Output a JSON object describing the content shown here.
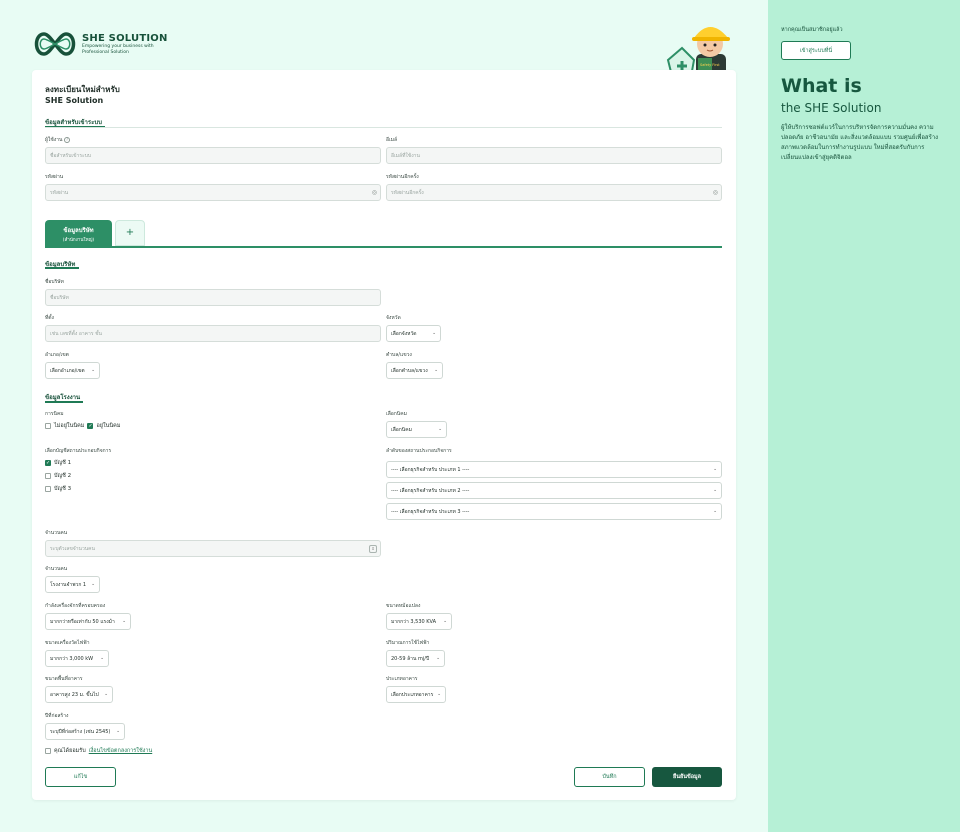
{
  "brand": {
    "name": "SHE SOLUTION",
    "tagline": "Empowering your business with Professional Solution"
  },
  "mascot": {
    "badge": "Safety First"
  },
  "header": {
    "title_line1": "ลงทะเบียนใหม่สำหรับ",
    "title_line2": "SHE Solution"
  },
  "login_section": {
    "heading": "ข้อมูลสำหรับเข้าระบบ",
    "username": {
      "label": "ผู้ใช้งาน",
      "placeholder": "ชื่อสำหรับเข้าระบบ"
    },
    "email": {
      "label": "อีเมล์",
      "placeholder": "อีเมล์ที่ใช้งาน"
    },
    "password": {
      "label": "รหัสผ่าน",
      "placeholder": "รหัสผ่าน"
    },
    "confirm_password": {
      "label": "รหัสผ่านอีกครั้ง",
      "placeholder": "รหัสผ่านอีกครั้ง"
    }
  },
  "tabs": {
    "active_title": "ข้อมูลบริษัท",
    "active_sub": "(สำนักงานใหญ่)",
    "add": "+"
  },
  "company": {
    "heading": "ข้อมูลบริษัท",
    "name": {
      "label": "ชื่อบริษัท",
      "placeholder": "ชื่อบริษัท"
    },
    "address": {
      "label": "ที่ตั้ง",
      "placeholder": "เช่น เลขที่ตั้ง อาคาร ชั้น"
    },
    "province": {
      "label": "จังหวัด",
      "value": "เลือกจังหวัด"
    },
    "district": {
      "label": "อำเภอ/เขต",
      "value": "เลือกอำเภอ/เขต"
    },
    "subdistrict": {
      "label": "ตำบล/แขวง",
      "value": "เลือกตำบล/แขวง"
    }
  },
  "factory": {
    "heading": "ข้อมูลโรงงาน",
    "estate": {
      "label": "การนิคม",
      "opt_no": "ไม่อยู่ในนิคม",
      "opt_yes": "อยู่ในนิคม"
    },
    "estate_select": {
      "label": "เลือกนิคม",
      "value": "เลือกนิคม"
    },
    "accounts": {
      "label": "เลือกบัญชีสถานประกอบกิจการ",
      "items": [
        "บัญชี 1",
        "บัญชี 2",
        "บัญชี 3"
      ]
    },
    "business_order": {
      "label": "ลำดับของสถานประกอบกิจการ",
      "items": [
        "---- เลือกธุรกิจสำหรับ ประเภท 1 ----",
        "---- เลือกธุรกิจสำหรับ ประเภท 2 ----",
        "---- เลือกธุรกิจสำหรับ ประเภท 3 ----"
      ]
    },
    "employees": {
      "label": "จำนวนคน",
      "placeholder": "ระบุตัวเลขจำนวนคน"
    },
    "factory_count": {
      "label": "จำนวนคน",
      "value": "โรงงานจำพวก 1"
    },
    "machine_power": {
      "label": "กำลังเครื่องจักรที่ครอบครอง",
      "value": "มากกว่าหรือเท่ากับ 50 แรงม้า"
    },
    "transformer": {
      "label": "ขนาดหม้อแปลง",
      "value": "มากกว่า 3,530 KVA"
    },
    "meter": {
      "label": "ขนาดเครื่องวัดไฟฟ้า",
      "value": "มากกว่า 3,000 kW"
    },
    "electric_usage": {
      "label": "ปริมาณการใช้ไฟฟ้า",
      "value": "20-59 ล้าน mj/ปี"
    },
    "building_area": {
      "label": "ขนาดพื้นที่อาคาร",
      "value": "อาคารสูง 23 ม. ขึ้นไป"
    },
    "building_type": {
      "label": "ประเภทอาคาร",
      "value": "เลือกประเภทอาคาร"
    },
    "build_year": {
      "label": "ปีที่ก่อสร้าง",
      "value": "ระบุปีที่ก่อสร้าง (เช่น 2545)"
    }
  },
  "consent": {
    "text": "คุณได้ยอมรับ",
    "link": "เงื่อนไขข้อตกลงการใช้งาน"
  },
  "actions": {
    "back": "แก้ไข",
    "save": "บันทึก",
    "confirm": "ยืนยันข้อมูล"
  },
  "sidebar": {
    "member_prompt": "หากคุณเป็นสมาชิกอยู่แล้ว",
    "login_button": "เข้าสู่ระบบที่นี่",
    "what": "What is",
    "the": "the SHE Solution",
    "description": "ผู้ให้บริการซอฟต์แวร์ในการบริหารจัดการความมั่นคง ความปลอดภัย อาชีวอนามัย และสิ่งแวดล้อมแบบ รวมศูนย์เพื่อสร้างสภาพแวดล้อมในการทำงานรูปแบบ ใหม่ที่สอดรับกับการเปลี่ยนแปลงเข้าสู่ยุคดิจิตอล"
  },
  "colors": {
    "primary": "#17573f",
    "accent": "#2d8f66",
    "sidebar_bg": "#b6f0d6",
    "page_bg": "#e8fcf4"
  },
  "icons": [
    "help-icon",
    "eye-off-icon",
    "plus-icon",
    "chevron-down-icon",
    "check-icon"
  ]
}
